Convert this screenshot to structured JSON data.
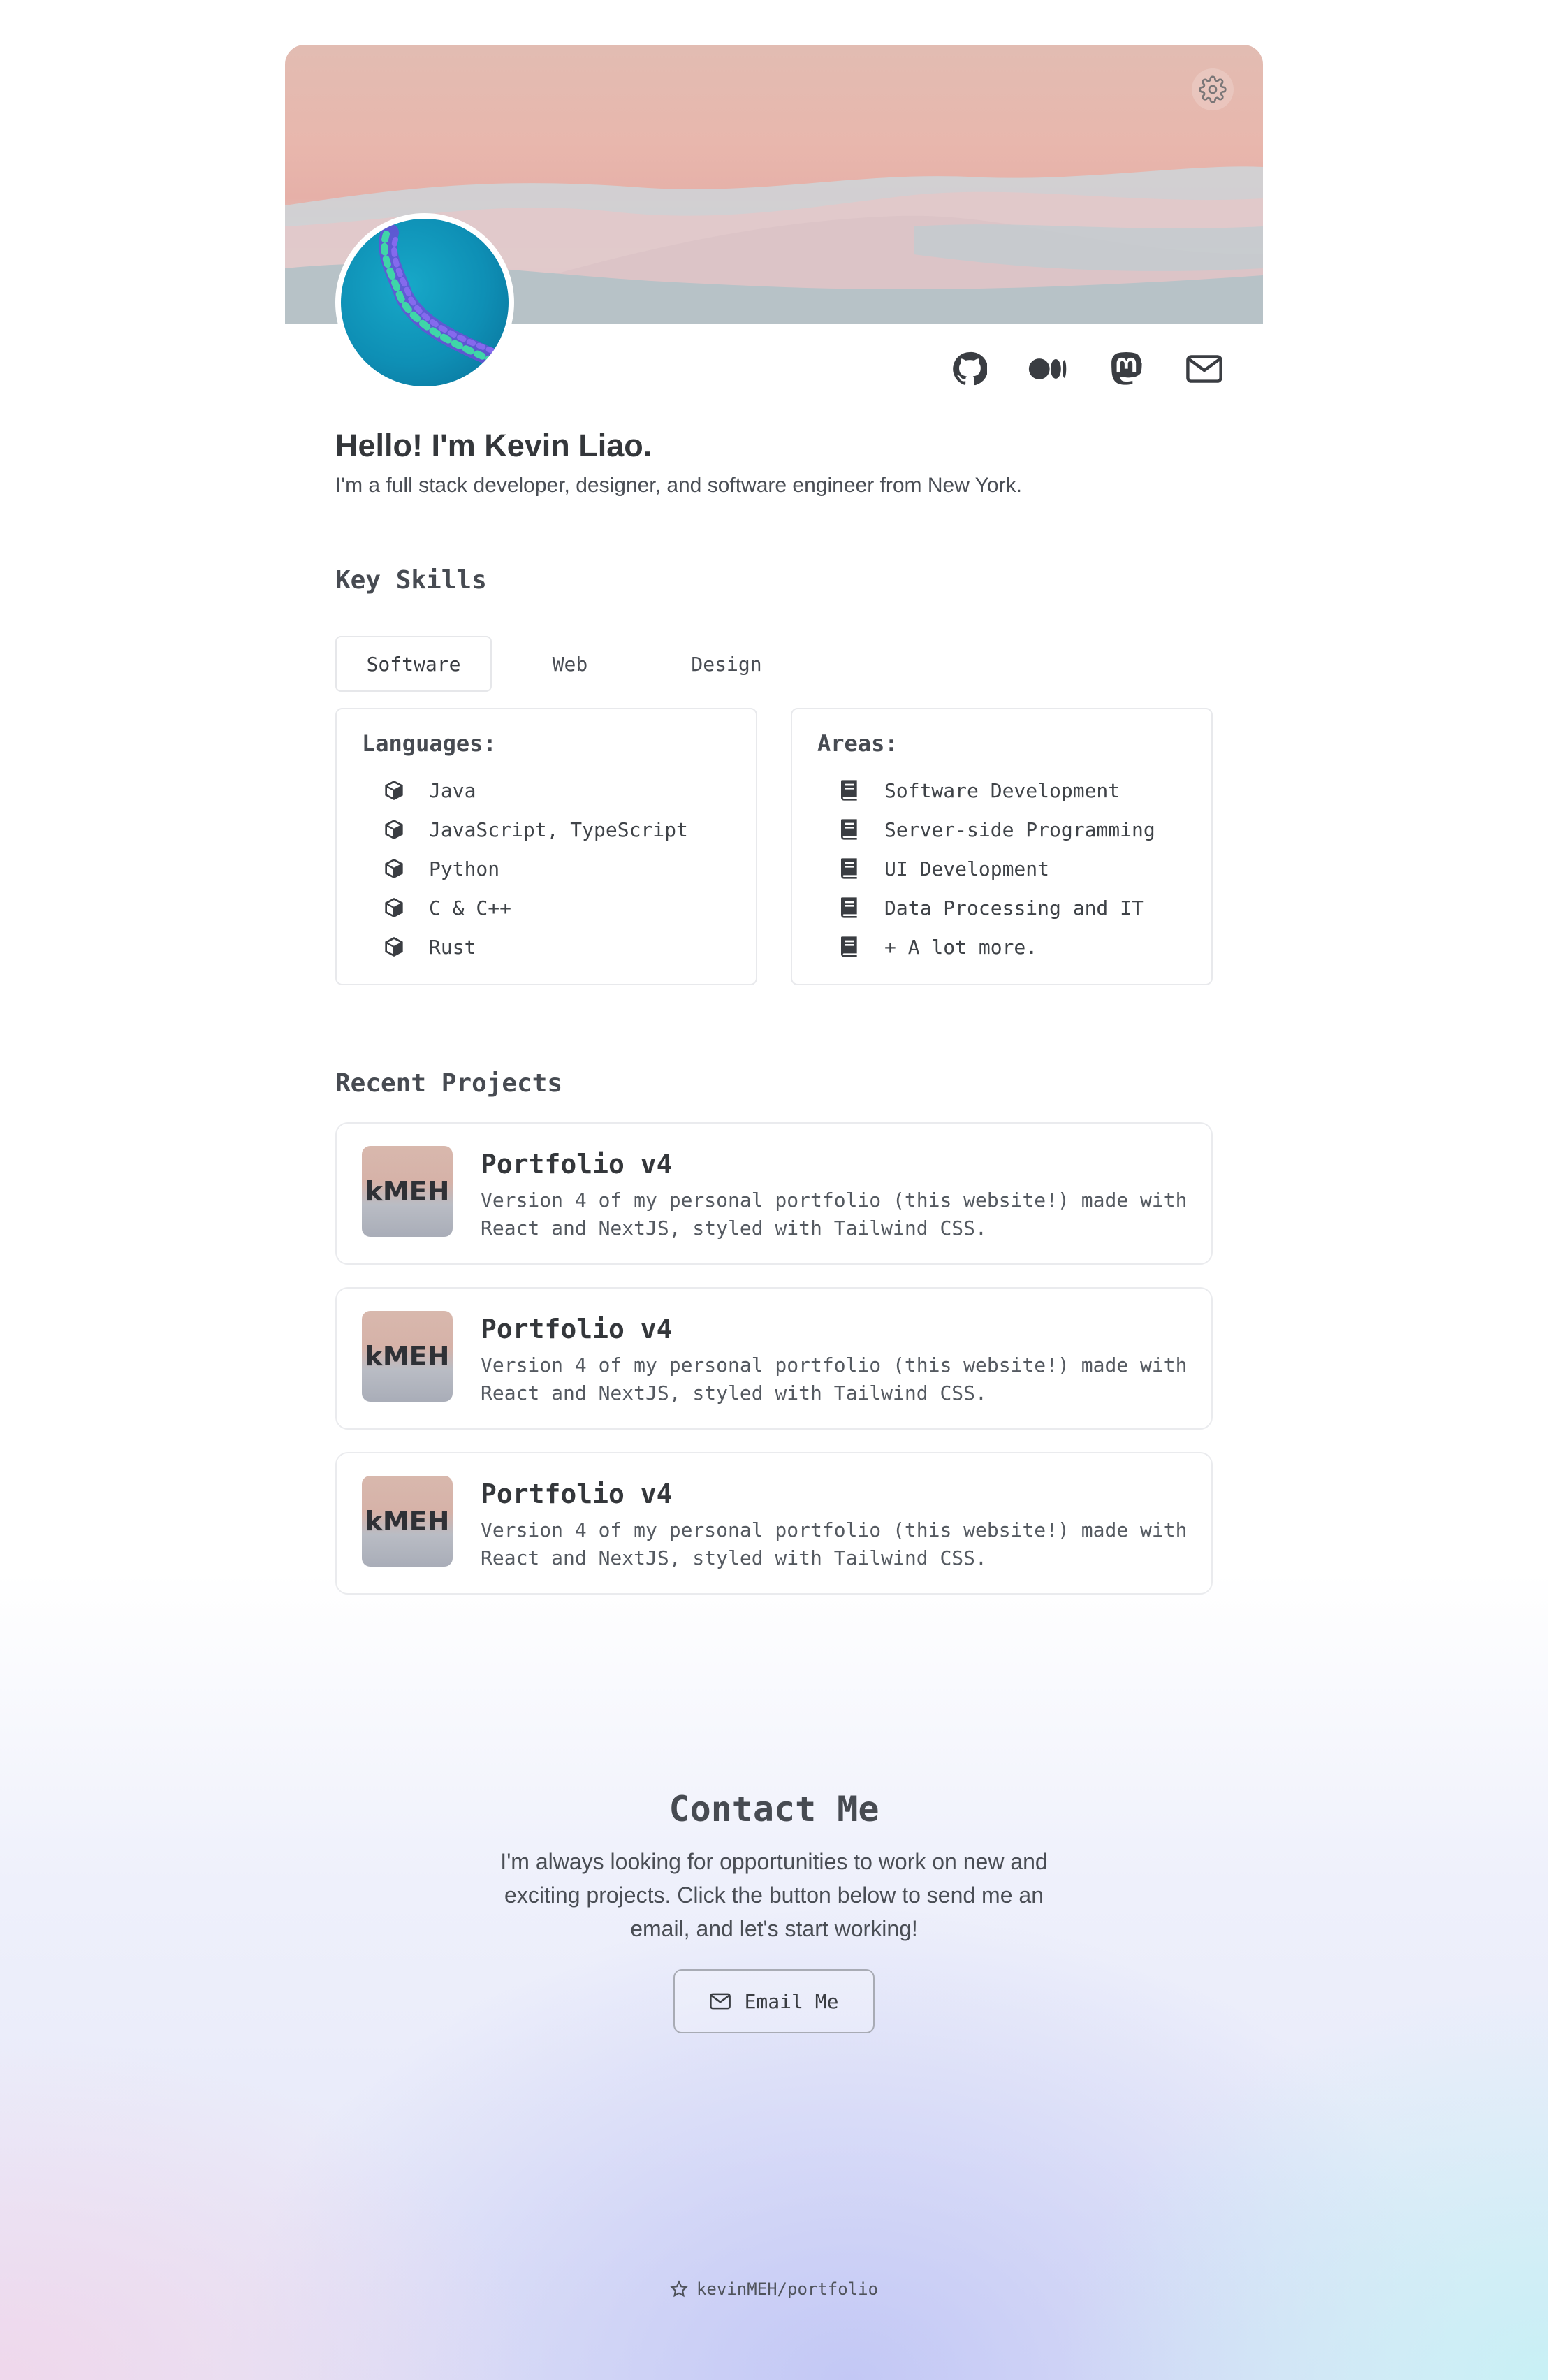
{
  "header": {
    "settings_icon": "gear-icon",
    "avatar_alt": "profile avatar",
    "socials": [
      {
        "name": "github",
        "icon": "github-icon"
      },
      {
        "name": "medium",
        "icon": "medium-icon"
      },
      {
        "name": "mastodon",
        "icon": "mastodon-icon"
      },
      {
        "name": "email",
        "icon": "envelope-icon"
      }
    ]
  },
  "intro": {
    "greeting": "Hello! I'm Kevin Liao.",
    "subtitle": "I'm a full stack developer, designer, and software engineer from New York."
  },
  "skills": {
    "title": "Key Skills",
    "tabs": [
      {
        "label": "Software",
        "active": true
      },
      {
        "label": "Web",
        "active": false
      },
      {
        "label": "Design",
        "active": false
      }
    ],
    "languages": {
      "heading": "Languages:",
      "icon": "cube-icon",
      "items": [
        "Java",
        "JavaScript, TypeScript",
        "Python",
        "C & C++",
        "Rust"
      ]
    },
    "areas": {
      "heading": "Areas:",
      "icon": "book-icon",
      "items": [
        "Software Development",
        "Server-side Programming",
        "UI Development",
        "Data Processing and IT",
        "+ A lot more."
      ]
    }
  },
  "projects": {
    "title": "Recent Projects",
    "items": [
      {
        "thumb": "kMEH",
        "title": "Portfolio v4",
        "description": "Version 4 of my personal portfolio (this website!) made with React and NextJS, styled with Tailwind CSS."
      },
      {
        "thumb": "kMEH",
        "title": "Portfolio v4",
        "description": "Version 4 of my personal portfolio (this website!) made with React and NextJS, styled with Tailwind CSS."
      },
      {
        "thumb": "kMEH",
        "title": "Portfolio v4",
        "description": "Version 4 of my personal portfolio (this website!) made with React and NextJS, styled with Tailwind CSS."
      }
    ]
  },
  "contact": {
    "title": "Contact Me",
    "text": "I'm always looking for opportunities to work on new and exciting projects. Click the button below to send me an email, and let's start working!",
    "button_label": "Email Me",
    "button_icon": "envelope-icon"
  },
  "footer": {
    "icon": "star-icon",
    "repo": "kevinMEH/portfolio"
  },
  "colors": {
    "text": "#3a3d42",
    "banner_pink": "#e8b7ad",
    "banner_dune": "#b4c0c5",
    "avatar_blue": "#0e8fb5"
  }
}
